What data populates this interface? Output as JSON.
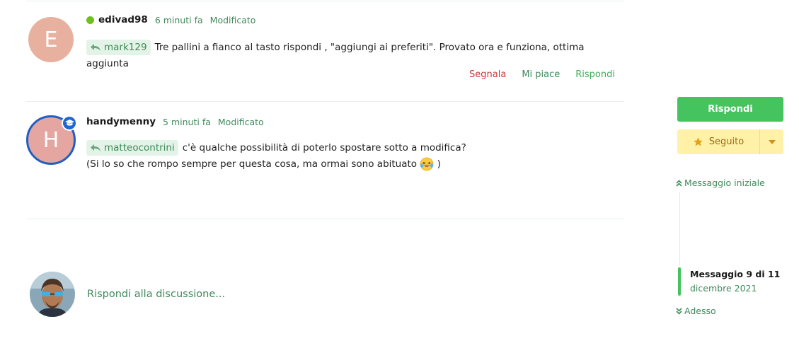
{
  "posts": [
    {
      "avatar_letter": "E",
      "username": "edivad98",
      "time": "6 minuti fa",
      "edited": "Modificato",
      "reply_to": "mark129",
      "text": "Tre pallini a fianco al tasto rispondi , \"aggiungi ai preferiti\". Provato ora e funziona, ottima aggiunta",
      "actions": {
        "report": "Segnala",
        "like": "Mi piace",
        "reply": "Rispondi"
      }
    },
    {
      "avatar_letter": "H",
      "username": "handymenny",
      "time": "5 minuti fa",
      "edited": "Modificato",
      "reply_to": "matteocontrini",
      "text_line1": "c'è qualche possibilità di poterlo spostare sotto a modifica?",
      "text_line2": "(Si lo so che rompo sempre per questa cosa, ma ormai sono abituato",
      "text_line2_end": ")"
    }
  ],
  "composer": {
    "placeholder": "Rispondi alla discussione..."
  },
  "sidebar": {
    "reply_button": "Rispondi",
    "follow_button": "Seguito",
    "timeline_start": "Messaggio iniziale",
    "position": "Messaggio 9 di 11",
    "position_date": "dicembre 2021",
    "timeline_end": "Adesso"
  },
  "colors": {
    "accent": "#45c35e",
    "link_green": "#3f8a5b",
    "report_red": "#c23b3b",
    "follow_yellow": "#fff2a8",
    "online": "#6fbf1f"
  }
}
